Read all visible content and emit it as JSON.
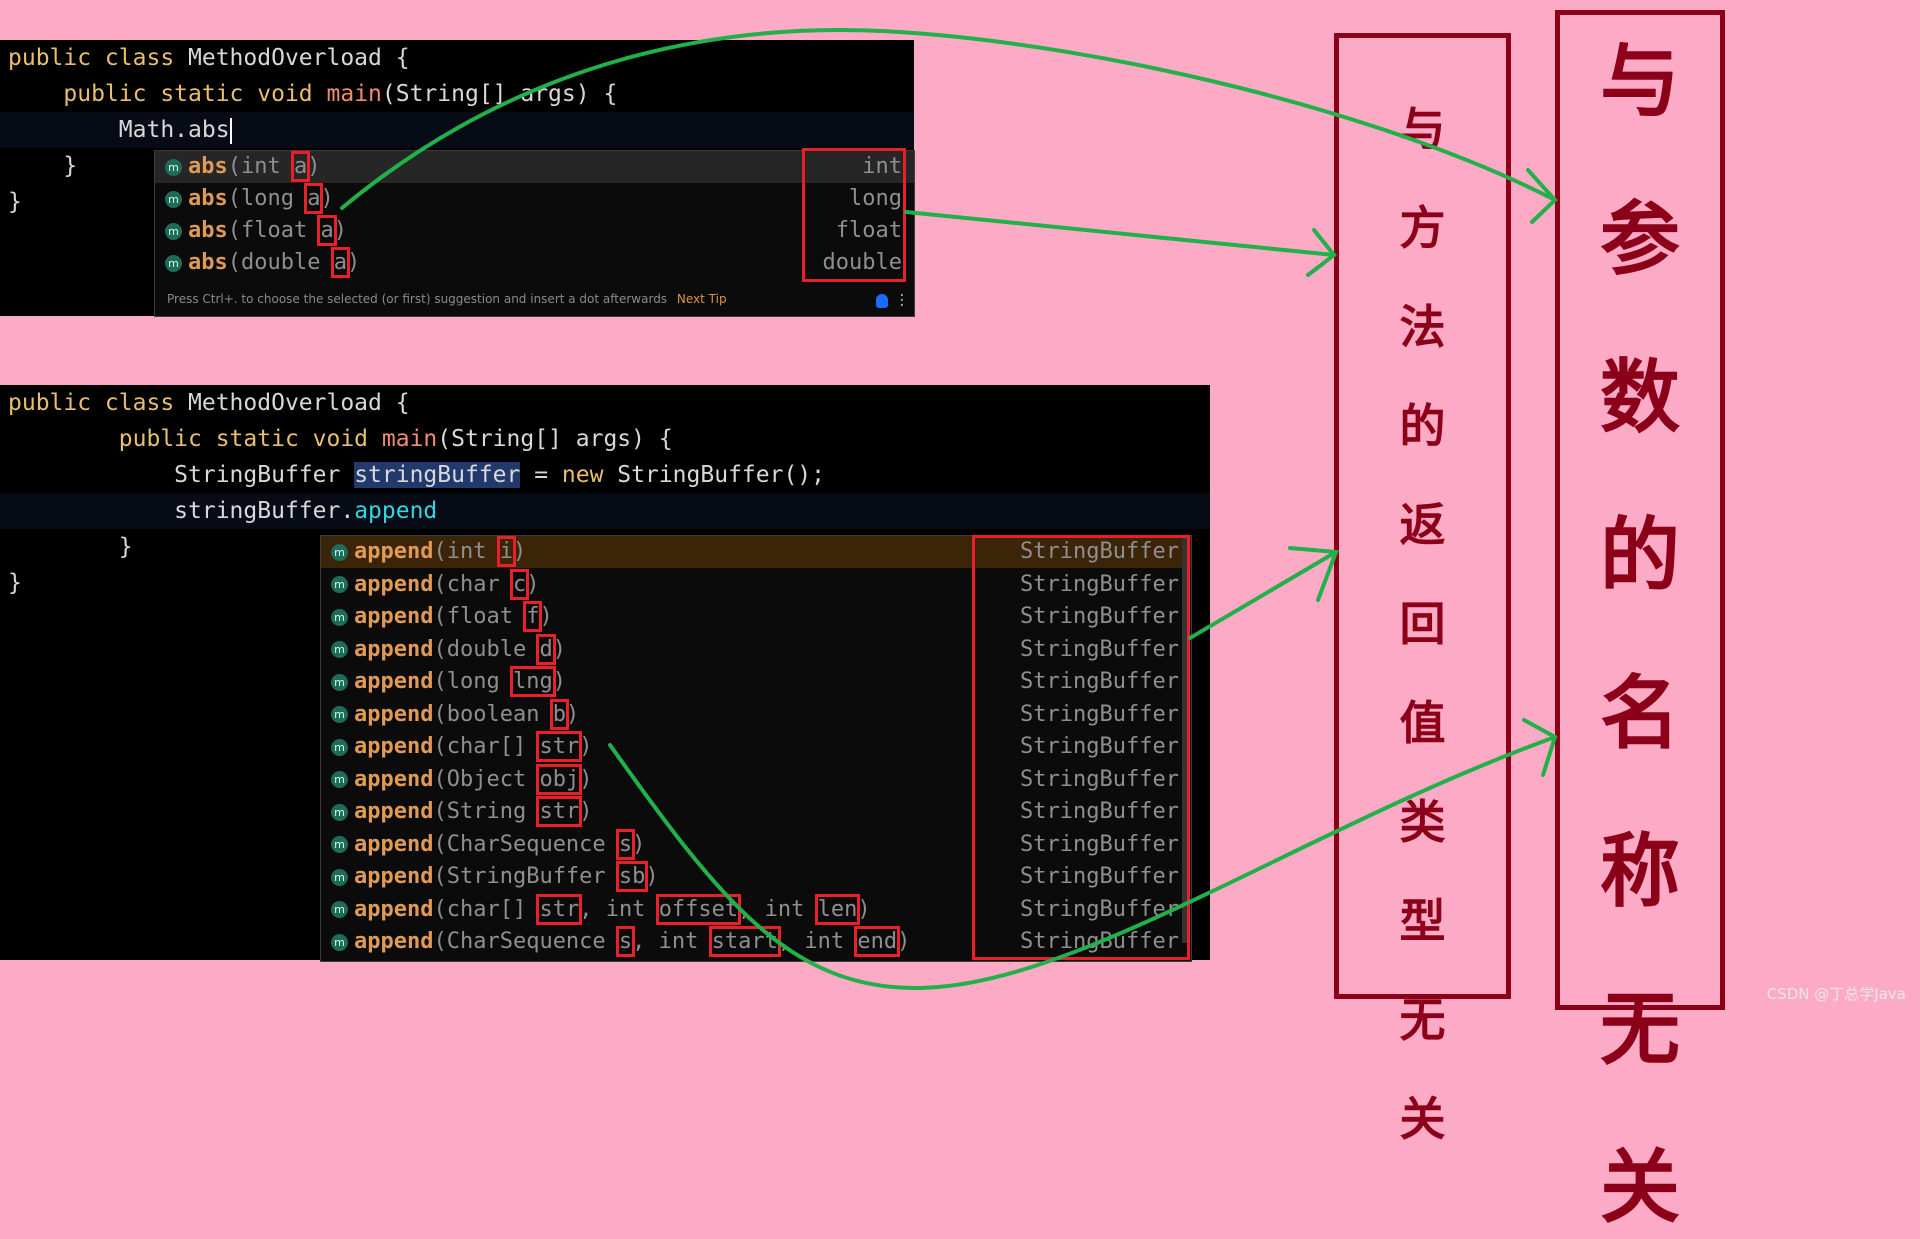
{
  "editor1": {
    "lines": [
      {
        "kw": "public class ",
        "text": "MethodOverload {"
      },
      {
        "indent": "    ",
        "kw": "public static void ",
        "fn": "main",
        "text": "(String[] args) {"
      },
      {
        "indent": "        ",
        "text": "Math.abs"
      },
      {
        "indent": "    ",
        "text": "}"
      },
      {
        "text": "}"
      }
    ],
    "popup": {
      "items": [
        {
          "icon": "m",
          "name": "abs",
          "params_prefix": "(int ",
          "param": "a",
          "suffix": ")",
          "return_type": "int",
          "selected": true
        },
        {
          "icon": "m",
          "name": "abs",
          "params_prefix": "(long ",
          "param": "a",
          "suffix": ")",
          "return_type": "long"
        },
        {
          "icon": "m",
          "name": "abs",
          "params_prefix": "(float ",
          "param": "a",
          "suffix": ")",
          "return_type": "float"
        },
        {
          "icon": "m",
          "name": "abs",
          "params_prefix": "(double ",
          "param": "a",
          "suffix": ")",
          "return_type": "double"
        }
      ],
      "footer_text": "Press Ctrl+. to choose the selected (or first) suggestion and insert a dot afterwards",
      "next_tip": "Next Tip"
    }
  },
  "editor2": {
    "lines": [
      {
        "kw": "public class ",
        "text": "MethodOverload {"
      },
      {
        "indent": "        ",
        "kw": "public static void ",
        "fn": "main",
        "text": "(String[] args) {"
      },
      {
        "indent": "            ",
        "pre": "StringBuffer ",
        "sel": "stringBuffer",
        "mid": " = ",
        "kw2": "new ",
        "text": "StringBuffer();"
      },
      {
        "indent": "            ",
        "pre": "stringBuffer.",
        "mem": "append"
      },
      {
        "indent": "        ",
        "text": "}"
      },
      {
        "text": "}"
      }
    ],
    "popup": {
      "items": [
        {
          "name": "append",
          "params_prefix": "(int ",
          "param": "i",
          "suffix": ")",
          "return_type": "StringBuffer",
          "selected": true
        },
        {
          "name": "append",
          "params_prefix": "(char ",
          "param": "c",
          "suffix": ")",
          "return_type": "StringBuffer"
        },
        {
          "name": "append",
          "params_prefix": "(float ",
          "param": "f",
          "suffix": ")",
          "return_type": "StringBuffer"
        },
        {
          "name": "append",
          "params_prefix": "(double ",
          "param": "d",
          "suffix": ")",
          "return_type": "StringBuffer"
        },
        {
          "name": "append",
          "params_prefix": "(long ",
          "param": "lng",
          "suffix": ")",
          "return_type": "StringBuffer"
        },
        {
          "name": "append",
          "params_prefix": "(boolean ",
          "param": "b",
          "suffix": ")",
          "return_type": "StringBuffer"
        },
        {
          "name": "append",
          "params_prefix": "(char[] ",
          "param": "str",
          "suffix": ")",
          "return_type": "StringBuffer"
        },
        {
          "name": "append",
          "params_prefix": "(Object ",
          "param": "obj",
          "suffix": ")",
          "return_type": "StringBuffer"
        },
        {
          "name": "append",
          "params_prefix": "(String ",
          "param": "str",
          "suffix": ")",
          "return_type": "StringBuffer"
        },
        {
          "name": "append",
          "params_prefix": "(CharSequence ",
          "param": "s",
          "suffix": ")",
          "return_type": "StringBuffer"
        },
        {
          "name": "append",
          "params_prefix": "(StringBuffer ",
          "param": "sb",
          "suffix": ")",
          "return_type": "StringBuffer"
        },
        {
          "name": "append",
          "params_prefix": "(char[] ",
          "param": "str",
          "p2pre": ", int ",
          "param2": "offset",
          "p3pre": ", int ",
          "param3": "len",
          "suffix": ")",
          "return_type": "StringBuffer"
        },
        {
          "name": "append",
          "params_prefix": "(CharSequence ",
          "param": "s",
          "p2pre": ", int ",
          "param2": "start",
          "p3pre": ", int ",
          "param3": "end",
          "suffix": ")",
          "return_type": "StringBuffer"
        }
      ]
    }
  },
  "annotations": {
    "return_type_box": {
      "chars": [
        "与",
        "方",
        "法",
        "的",
        "返",
        "回",
        "值",
        "类",
        "型",
        "无",
        "关"
      ]
    },
    "param_name_box": {
      "chars": [
        "与",
        "参",
        "数",
        "的",
        "名",
        "称",
        "无",
        "关"
      ]
    }
  },
  "colors": {
    "background": "#fdaac6",
    "annotation_red": "#8b0018",
    "highlight_red": "#e8202a",
    "arrow_green": "#22b04b"
  },
  "watermark": "CSDN @丁总学Java"
}
